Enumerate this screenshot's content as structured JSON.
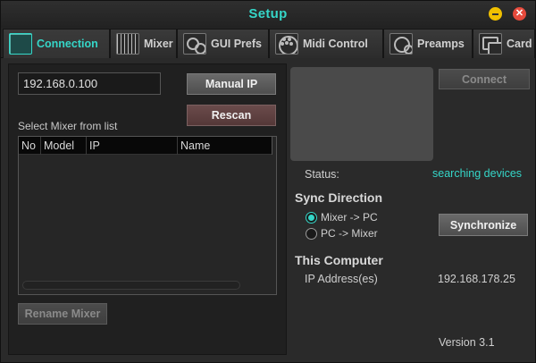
{
  "window": {
    "title": "Setup",
    "minimize_label": "",
    "close_label": "✕",
    "accent": "#35d6c8"
  },
  "tabs": [
    {
      "label": "Connection",
      "icon": "connection-grid-icon",
      "active": true
    },
    {
      "label": "Mixer",
      "icon": "faders-icon"
    },
    {
      "label": "GUI Prefs",
      "icon": "gears-icon"
    },
    {
      "label": "Midi Control",
      "icon": "midi-connector-icon"
    },
    {
      "label": "Preamps",
      "icon": "preamp-knob-icon"
    },
    {
      "label": "Card",
      "icon": "card-icon"
    }
  ],
  "connection": {
    "ip_value": "192.168.0.100",
    "manual_ip_label": "Manual IP",
    "rescan_label": "Rescan",
    "list_label": "Select Mixer from list",
    "columns": [
      "No",
      "Model",
      "IP",
      "Name"
    ],
    "rows": [],
    "rename_label": "Rename Mixer",
    "connect_label": "Connect",
    "status_label": "Status:",
    "status_value": "searching devices"
  },
  "sync": {
    "heading": "Sync Direction",
    "options": [
      "Mixer -> PC",
      "PC -> Mixer"
    ],
    "selected": "Mixer -> PC",
    "synchronize_label": "Synchronize"
  },
  "computer": {
    "heading": "This Computer",
    "ip_label": "IP Address(es)",
    "ip_value": "192.168.178.25"
  },
  "version": "Version 3.1"
}
